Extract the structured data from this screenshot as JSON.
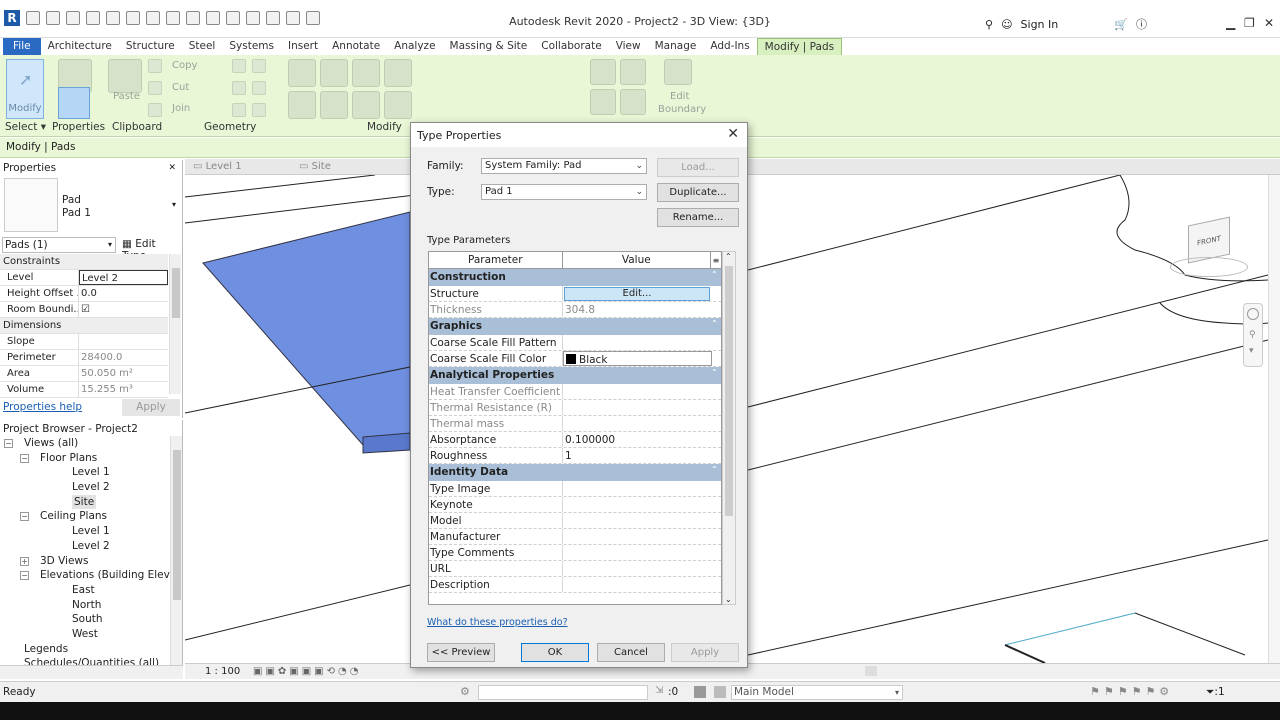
{
  "app": {
    "title": "Autodesk Revit 2020 - Project2 - 3D View: {3D}",
    "sign_in": "Sign In"
  },
  "menu": [
    "Architecture",
    "Structure",
    "Steel",
    "Systems",
    "Insert",
    "Annotate",
    "Analyze",
    "Massing & Site",
    "Collaborate",
    "View",
    "Manage",
    "Add-Ins",
    "Modify | Pads"
  ],
  "menu_file": "File",
  "ribbon": {
    "modify": "Modify",
    "paste": "Paste",
    "copy": "Copy",
    "cut": "Cut",
    "join": "Join",
    "edit_boundary_1": "Edit",
    "edit_boundary_2": "Boundary",
    "panels": {
      "select": "Select",
      "properties": "Properties",
      "clipboard": "Clipboard",
      "geometry": "Geometry",
      "modify": "Modify"
    }
  },
  "context_bar": "Modify | Pads",
  "properties": {
    "header": "Properties",
    "type_line1": "Pad",
    "type_line2": "Pad 1",
    "selector": "Pads (1)",
    "edit_type": "Edit Type",
    "rows": [
      {
        "section": "Constraints"
      },
      {
        "k": "Level",
        "v": "Level 2",
        "box": true
      },
      {
        "k": "Height Offset ...",
        "v": "0.0"
      },
      {
        "k": "Room Boundi...",
        "v": "☑"
      },
      {
        "section": "Dimensions"
      },
      {
        "k": "Slope",
        "v": "",
        "grey": true
      },
      {
        "k": "Perimeter",
        "v": "28400.0",
        "grey": true
      },
      {
        "k": "Area",
        "v": "50.050 m²",
        "grey": true
      },
      {
        "k": "Volume",
        "v": "15.255 m³",
        "grey": true
      }
    ],
    "help": "Properties help",
    "apply": "Apply"
  },
  "browser": {
    "header": "Project Browser - Project2",
    "nodes": [
      {
        "label": "Views (all)",
        "level": 0,
        "exp": "−"
      },
      {
        "label": "Floor Plans",
        "level": 1,
        "exp": "−"
      },
      {
        "label": "Level 1",
        "level": 2
      },
      {
        "label": "Level 2",
        "level": 2
      },
      {
        "label": "Site",
        "level": 2,
        "sel": true
      },
      {
        "label": "Ceiling Plans",
        "level": 1,
        "exp": "−"
      },
      {
        "label": "Level 1",
        "level": 2
      },
      {
        "label": "Level 2",
        "level": 2
      },
      {
        "label": "3D Views",
        "level": 1,
        "exp": "+"
      },
      {
        "label": "Elevations (Building Elevatio",
        "level": 1,
        "exp": "−"
      },
      {
        "label": "East",
        "level": 2
      },
      {
        "label": "North",
        "level": 2
      },
      {
        "label": "South",
        "level": 2
      },
      {
        "label": "West",
        "level": 2
      },
      {
        "label": "Legends",
        "level": 0
      },
      {
        "label": "Schedules/Quantities (all)",
        "level": 0
      }
    ]
  },
  "view_tabs": [
    "Level 1",
    "Site"
  ],
  "view_scale": "1 : 100",
  "viewcube_label": "FRONT",
  "status": {
    "ready": "Ready",
    "zero": ":0",
    "model": "Main Model",
    "filter": ":1"
  },
  "dialog": {
    "title": "Type Properties",
    "family_label": "Family:",
    "family_value": "System Family: Pad",
    "type_label": "Type:",
    "type_value": "Pad 1",
    "load": "Load...",
    "duplicate": "Duplicate...",
    "rename": "Rename...",
    "type_params": "Type Parameters",
    "col_param": "Parameter",
    "col_value": "Value",
    "rows": [
      {
        "group": "Construction"
      },
      {
        "p": "Structure",
        "v": "Edit...",
        "edit": true
      },
      {
        "p": "Thickness",
        "v": "304.8",
        "grey": true
      },
      {
        "group": "Graphics"
      },
      {
        "p": "Coarse Scale Fill Pattern",
        "v": ""
      },
      {
        "p": "Coarse Scale Fill Color",
        "v": "Black",
        "color": true
      },
      {
        "group": "Analytical Properties"
      },
      {
        "p": "Heat Transfer Coefficient (U)",
        "v": "",
        "grey": true
      },
      {
        "p": "Thermal Resistance (R)",
        "v": "",
        "grey": true
      },
      {
        "p": "Thermal mass",
        "v": "",
        "grey": true
      },
      {
        "p": "Absorptance",
        "v": "0.100000"
      },
      {
        "p": "Roughness",
        "v": "1"
      },
      {
        "group": "Identity Data"
      },
      {
        "p": "Type Image",
        "v": ""
      },
      {
        "p": "Keynote",
        "v": ""
      },
      {
        "p": "Model",
        "v": ""
      },
      {
        "p": "Manufacturer",
        "v": ""
      },
      {
        "p": "Type Comments",
        "v": ""
      },
      {
        "p": "URL",
        "v": ""
      },
      {
        "p": "Description",
        "v": ""
      }
    ],
    "what_link": "What do these properties do?",
    "preview": "<< Preview",
    "ok": "OK",
    "cancel": "Cancel",
    "apply": "Apply"
  }
}
